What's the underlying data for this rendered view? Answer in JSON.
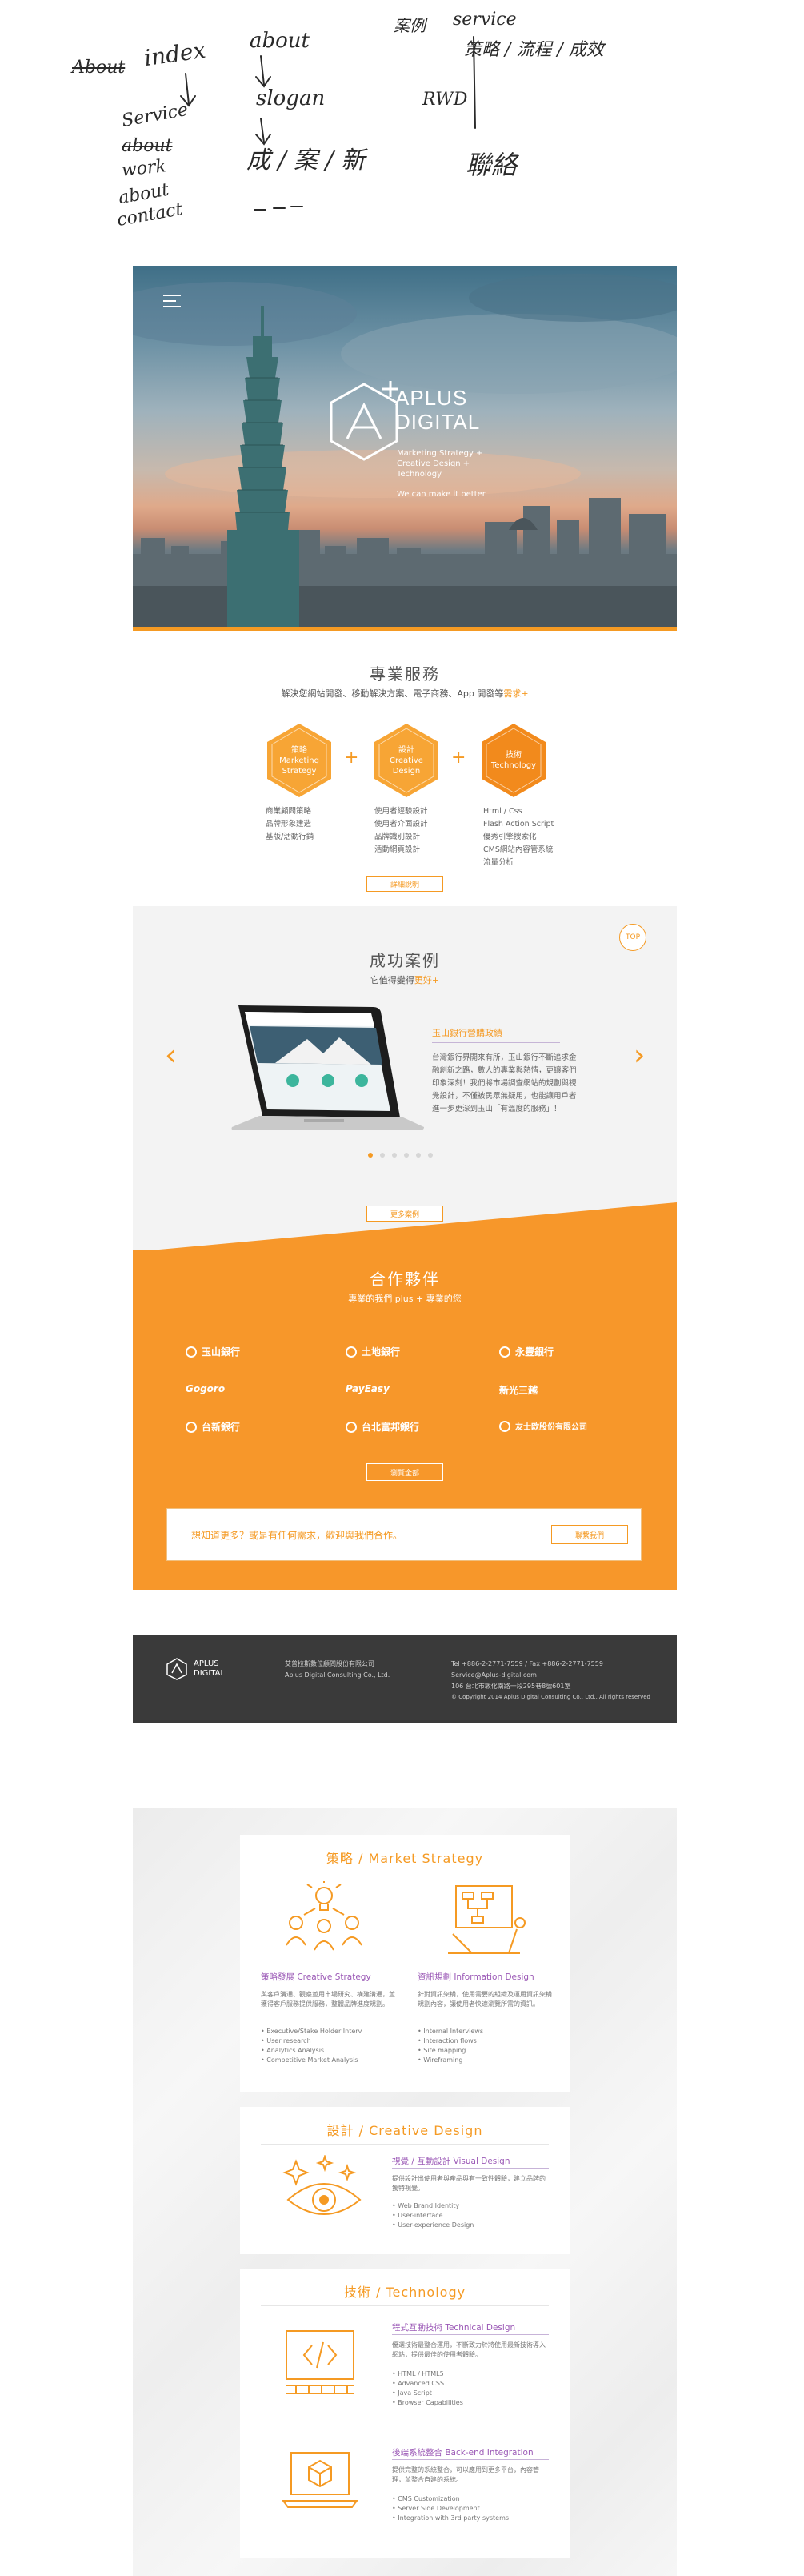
{
  "sketch": {
    "about_struck": "About",
    "index": "index",
    "about": "about",
    "col3_head": "案例",
    "service": "service",
    "service_list": "Service",
    "about_struck2": "about",
    "work": "work",
    "about_lower": "about",
    "contact": "contact",
    "slogan": "slogan",
    "col3_line": "策略 / 流程 / 成效",
    "rwd": "RWD",
    "bottom_mid": "成 / 案 / 新",
    "bottom_right": "聯絡"
  },
  "hero": {
    "brand_line1": "APLUS",
    "brand_line2": "DIGITAL",
    "tagline": "Marketing Strategy + Creative Design + Technology",
    "tagline2": "We can make it better"
  },
  "services": {
    "title": "專業服務",
    "subtitle_plain": "解決您網站開發、移動解決方案、電子商務、App 開發等",
    "subtitle_highlight": "需求+",
    "items": [
      {
        "zh": "策略",
        "en": "Marketing Strategy",
        "list": [
          "商業顧問策略",
          "品牌形象建造",
          "基版/活動行銷"
        ]
      },
      {
        "zh": "設計",
        "en": "Creative Design",
        "list": [
          "使用者經驗設計",
          "使用者介面設計",
          "品牌識別設計",
          "活動網頁設計"
        ]
      },
      {
        "zh": "技術",
        "en": "Technology",
        "list": [
          "Html / Css",
          "Flash Action Script",
          "優秀引擎搜索化",
          "CMS網站內容管系統",
          "流量分析"
        ]
      }
    ],
    "button": "詳細說明"
  },
  "cases": {
    "top_badge": "TOP",
    "title": "成功案例",
    "subtitle_plain": "它值得變得",
    "subtitle_highlight": "更好+",
    "case_title": "玉山銀行營購政績",
    "case_desc": "台灣銀行界開來有所，玉山銀行不斷追求金融創新之路，數人的專業與熱情，更讓客們印象深刻！我們將市場調查網站的規劃與視覺設計，不僅被民眾無疑用，也能讓用戶者進一步更深到玉山「有溫度的服務」！",
    "prev": "‹",
    "next": "›",
    "button": "更多案例"
  },
  "partners": {
    "title": "合作夥伴",
    "subtitle": "專業的我們 plus + 專業的您",
    "logos": [
      "玉山銀行",
      "土地銀行",
      "永豐銀行",
      "Gogoro",
      "PayEasy",
      "新光三越",
      "台新銀行",
      "台北富邦銀行",
      "友士欧股份有限公司"
    ],
    "button": "瀏覽全部",
    "cta_text": "想知道更多？或是有任何需求，歡迎與我們合作。",
    "cta_button": "聯繫我們"
  },
  "footer": {
    "logo_line1": "APLUS",
    "logo_line2": "DIGITAL",
    "company_zh": "艾普拉斯數位顧問股份有限公司",
    "company_en": "Aplus Digital Consulting Co., Ltd.",
    "phone": "Tel +886-2-2771-7559  /  Fax +886-2-2771-7559",
    "email": "Service@Aplus-digital.com",
    "address": "106 台北市敦化南路一段295巷8號601室",
    "copyright": "© Copyright 2014 Aplus Digital Consulting Co., Ltd.. All rights reserved"
  },
  "detail": {
    "strategy": {
      "heading": "策略 / Market Strategy",
      "blocks": [
        {
          "title": "策略發展 Creative Strategy",
          "desc": "與客戶溝通、觀察並用市場研究、構建溝通，並獲得客戶服務提供服務，整體品牌進度規劃。",
          "list": [
            "• Executive/Stake Holder Interv",
            "• User research",
            "• Analytics Analysis",
            "• Competitive Market Analysis"
          ]
        },
        {
          "title": "資訊規劃 Information Design",
          "desc": "針對資訊架構，使用需要的組織及運用資訊架構規劃內容，讓使用者快速瀏覽所需的資訊。",
          "list": [
            "• Internal Interviews",
            "• Interaction flows",
            "• Site mapping",
            "• Wireframing"
          ]
        }
      ]
    },
    "design": {
      "heading": "設計 / Creative Design",
      "block": {
        "title": "視覺 / 互動設計 Visual Design",
        "desc": "提供設計出使用者與產品與有一致性體驗，建立品牌的獨特視覺。",
        "list": [
          "• Web Brand Identity",
          "• User-interface",
          "• User-experience Design"
        ]
      }
    },
    "tech": {
      "heading": "技術 / Technology",
      "blocks": [
        {
          "title": "程式互動技術 Technical Design",
          "desc": "優選技術最整合運用，不斷致力於將使用最新技術導入網站，提供最佳的使用者體驗。",
          "list": [
            "• HTML / HTML5",
            "• Advanced CSS",
            "• Java Script",
            "• Browser Capabilities"
          ]
        },
        {
          "title": "後端系統整合 Back-end Integration",
          "desc": "提供完整的系統整合，可以應用到更多平台，內容管理，並整合自建的系統。",
          "list": [
            "• CMS Customization",
            "• Server Side Development",
            "• Integration with 3rd party systems"
          ]
        }
      ]
    }
  },
  "colors": {
    "accent": "#f59a23",
    "purple": "#9b59b6",
    "dark": "#3a3a3a"
  }
}
